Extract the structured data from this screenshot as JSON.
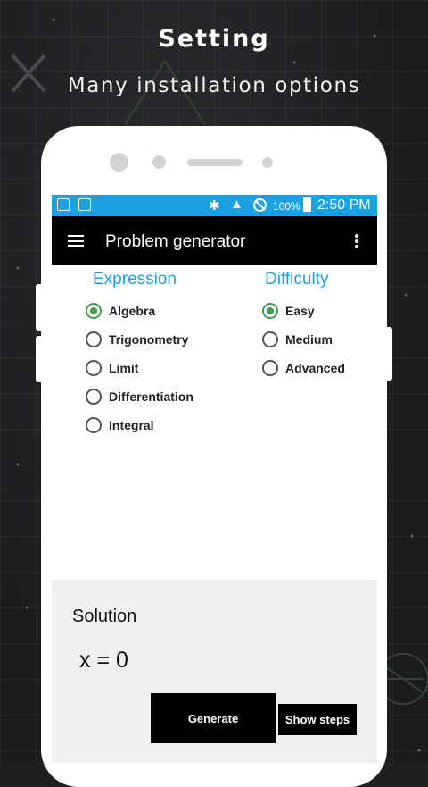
{
  "promo": {
    "title": "Setting",
    "subtitle": "Many installation options"
  },
  "status_bar": {
    "battery": "100%",
    "time": "2:50 PM",
    "bluetooth_icon": "bluetooth-icon",
    "wifi_icon": "wifi-icon"
  },
  "app_bar": {
    "title": "Problem generator",
    "menu_icon": "hamburger-menu-icon",
    "overflow_icon": "more-vert-icon"
  },
  "expression": {
    "heading": "Expression",
    "options": [
      "Algebra",
      "Trigonometry",
      "Limit",
      "Differentiation",
      "Integral"
    ],
    "selected": "Algebra"
  },
  "difficulty": {
    "heading": "Difficulty",
    "options": [
      "Easy",
      "Medium",
      "Advanced"
    ],
    "selected": "Easy"
  },
  "solution": {
    "label": "Solution",
    "value": "x = 0"
  },
  "buttons": {
    "generate": "Generate",
    "show_steps": "Show steps"
  },
  "colors": {
    "accent": "#1ba1e2",
    "radio_selected": "#3aa34a",
    "app_bar": "#000000",
    "background": "#1f2022"
  }
}
